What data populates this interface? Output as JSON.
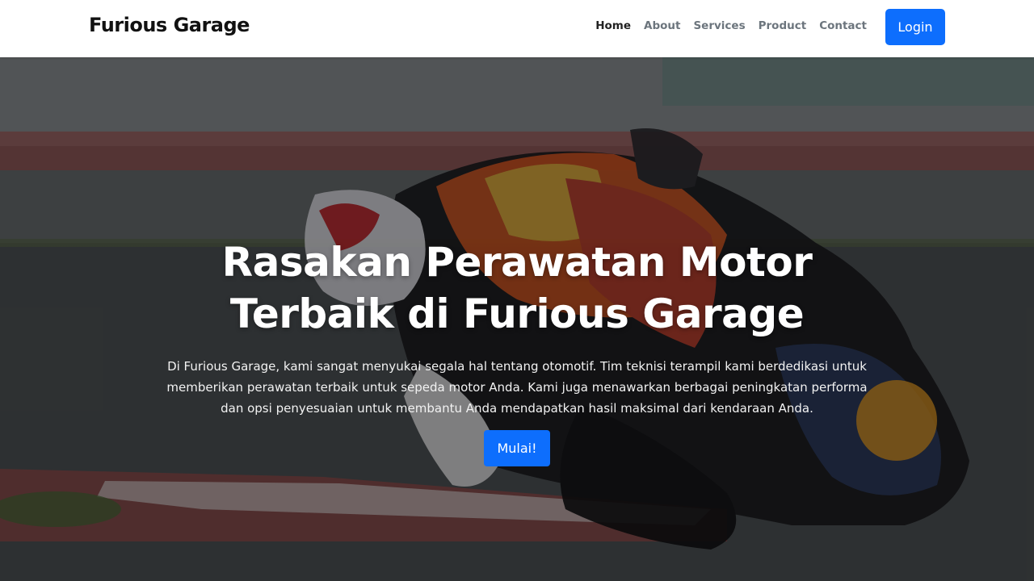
{
  "navbar": {
    "brand": "Furious Garage",
    "links": [
      {
        "label": "Home",
        "active": true
      },
      {
        "label": "About",
        "active": false
      },
      {
        "label": "Services",
        "active": false
      },
      {
        "label": "Product",
        "active": false
      },
      {
        "label": "Contact",
        "active": false
      }
    ],
    "login_label": "Login"
  },
  "hero": {
    "title_line1": "Rasakan Perawatan Motor",
    "title_line2": "Terbaik di Furious Garage",
    "description": "Di Furious Garage, kami sangat menyukai segala hal tentang otomotif. Tim teknisi terampil kami berdedikasi untuk memberikan perawatan terbaik untuk sepeda motor Anda. Kami juga menawarkan berbagai peningkatan performa dan opsi penyesuaian untuk membantu Anda mendapatkan hasil maksimal dari kendaraan Anda.",
    "cta_label": "Mulai!"
  },
  "colors": {
    "primary": "#0d6efd",
    "nav_active": "#222222",
    "nav_muted": "#6c757d"
  }
}
